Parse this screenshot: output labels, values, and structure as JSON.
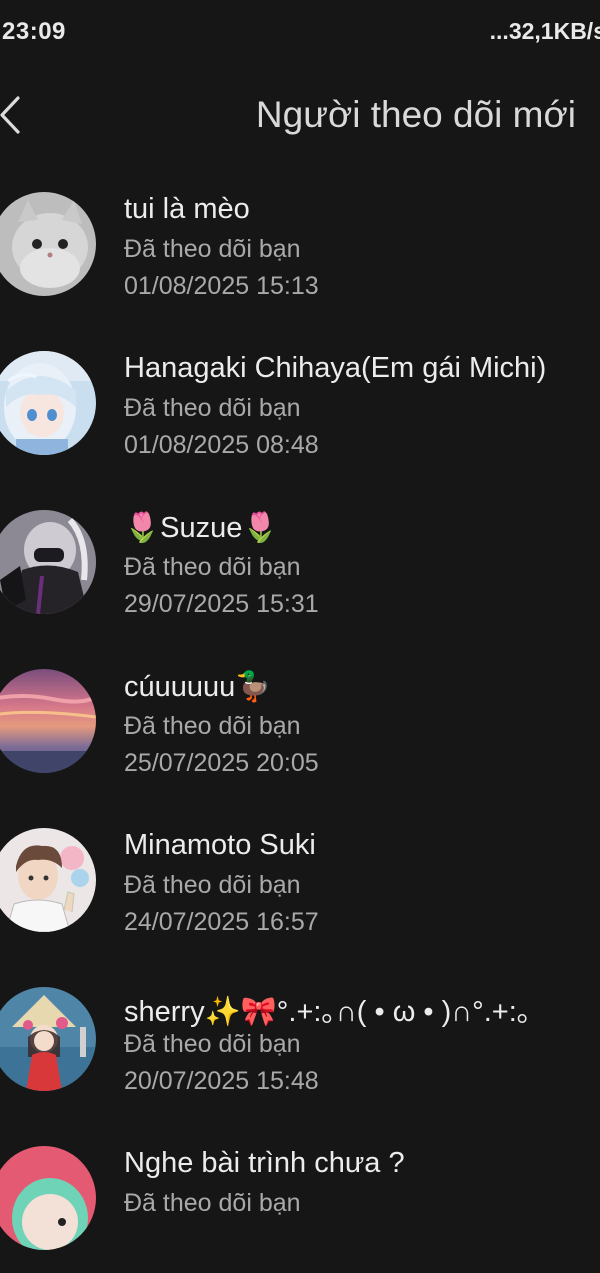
{
  "status_bar": {
    "time": "23:09",
    "network_speed": "...32,1KB/s"
  },
  "header": {
    "back_icon": "chevron-left-icon",
    "title": "Người theo dõi mới"
  },
  "followers": [
    {
      "name": "tui là mèo",
      "status": "Đã theo dõi bạn",
      "time": "01/08/2025 15:13"
    },
    {
      "name": "Hanagaki Chihaya(Em gái Michi)",
      "status": "Đã theo dõi bạn",
      "time": "01/08/2025 08:48"
    },
    {
      "name": "🌷Suzue🌷",
      "status": "Đã theo dõi bạn",
      "time": "29/07/2025 15:31"
    },
    {
      "name": "cúuuuuu🦆",
      "status": "Đã theo dõi bạn",
      "time": "25/07/2025 20:05"
    },
    {
      "name": "Minamoto Suki",
      "status": "Đã theo dõi bạn",
      "time": "24/07/2025 16:57"
    },
    {
      "name": "sherry✨🎀°.+:｡∩( • ω • )∩°.+:｡",
      "status": "Đã theo dõi bạn",
      "time": "20/07/2025 15:48"
    },
    {
      "name": "Nghe bài trình chưa ?",
      "status": "Đã theo dõi bạn",
      "time": ""
    }
  ]
}
